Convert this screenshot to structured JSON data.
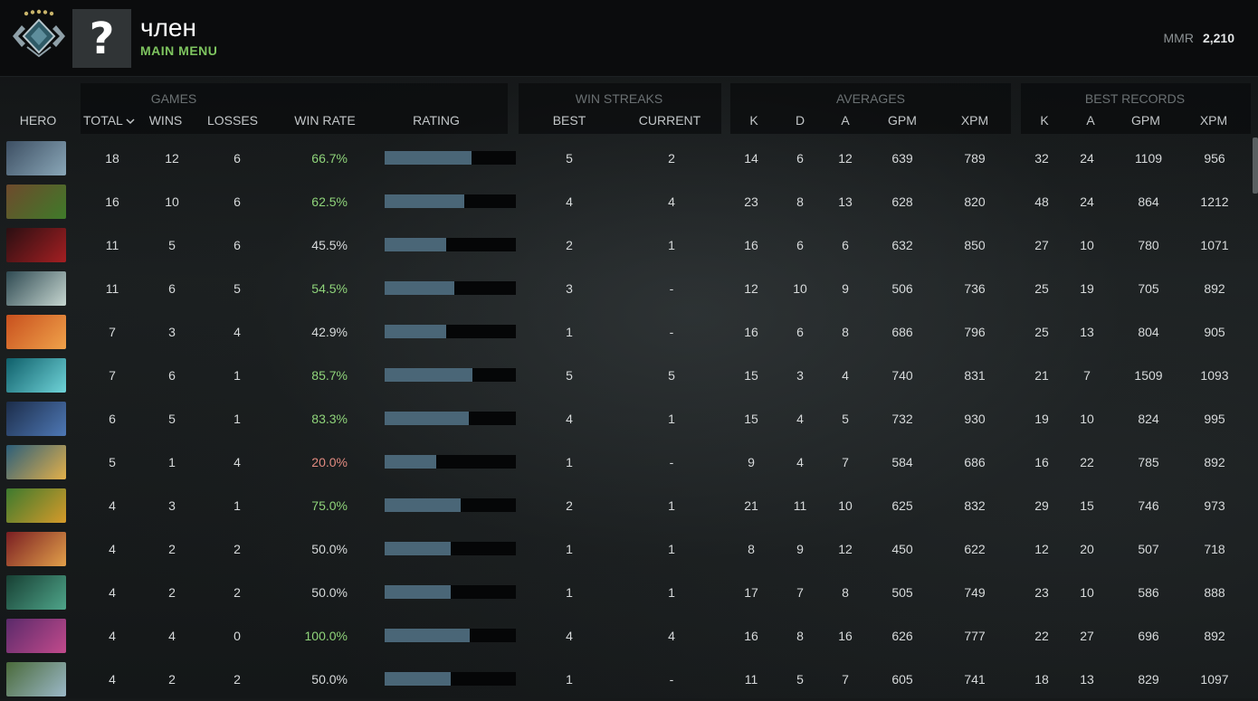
{
  "header": {
    "player_name": "член",
    "subtitle": "MAIN MENU",
    "mmr_label": "MMR",
    "mmr_value": "2,210"
  },
  "groups": {
    "games": "GAMES",
    "win_streaks": "WIN STREAKS",
    "averages": "AVERAGES",
    "best_records": "BEST RECORDS"
  },
  "columns": {
    "hero": "HERO",
    "total": "TOTAL",
    "total_sort_icon": "chevron-down-icon",
    "wins": "WINS",
    "losses": "LOSSES",
    "win_rate": "WIN RATE",
    "rating": "RATING",
    "best": "BEST",
    "current": "CURRENT",
    "k": "K",
    "d": "D",
    "a": "A",
    "gpm": "GPM",
    "xpm": "XPM",
    "best_k": "K",
    "best_a": "A",
    "best_gpm": "GPM",
    "best_xpm": "XPM"
  },
  "colors": {
    "winrate_good": "#8fd47a",
    "winrate_bad": "#e28b80",
    "winrate_even": "#d7dadb",
    "rating_bar": "#4a6677"
  },
  "rows": [
    {
      "hero_icon": "hero-portrait-icon",
      "c1": "#3d4f63",
      "c2": "#8aa7b8",
      "total": "18",
      "wins": "12",
      "losses": "6",
      "win_rate": "66.7%",
      "wr_tone": "good",
      "rating": 0.66,
      "best": "5",
      "current": "2",
      "k": "14",
      "d": "6",
      "a": "12",
      "gpm": "639",
      "xpm": "789",
      "bk": "32",
      "ba": "24",
      "bgpm": "1109",
      "bxpm": "956"
    },
    {
      "hero_icon": "hero-portrait-icon",
      "c1": "#6e4a2c",
      "c2": "#3f7a2a",
      "total": "16",
      "wins": "10",
      "losses": "6",
      "win_rate": "62.5%",
      "wr_tone": "good",
      "rating": 0.61,
      "best": "4",
      "current": "4",
      "k": "23",
      "d": "8",
      "a": "13",
      "gpm": "628",
      "xpm": "820",
      "bk": "48",
      "ba": "24",
      "bgpm": "864",
      "bxpm": "1212"
    },
    {
      "hero_icon": "hero-portrait-icon",
      "c1": "#2a0f12",
      "c2": "#a41f22",
      "total": "11",
      "wins": "5",
      "losses": "6",
      "win_rate": "45.5%",
      "wr_tone": "even",
      "rating": 0.47,
      "best": "2",
      "current": "1",
      "k": "16",
      "d": "6",
      "a": "6",
      "gpm": "632",
      "xpm": "850",
      "bk": "27",
      "ba": "10",
      "bgpm": "780",
      "bxpm": "1071"
    },
    {
      "hero_icon": "hero-portrait-icon",
      "c1": "#2f4a52",
      "c2": "#c6d6d0",
      "total": "11",
      "wins": "6",
      "losses": "5",
      "win_rate": "54.5%",
      "wr_tone": "good",
      "rating": 0.53,
      "best": "3",
      "current": "-",
      "k": "12",
      "d": "10",
      "a": "9",
      "gpm": "506",
      "xpm": "736",
      "bk": "25",
      "ba": "19",
      "bgpm": "705",
      "bxpm": "892"
    },
    {
      "hero_icon": "hero-portrait-icon",
      "c1": "#c8501e",
      "c2": "#f0a24a",
      "total": "7",
      "wins": "3",
      "losses": "4",
      "win_rate": "42.9%",
      "wr_tone": "even",
      "rating": 0.47,
      "best": "1",
      "current": "-",
      "k": "16",
      "d": "6",
      "a": "8",
      "gpm": "686",
      "xpm": "796",
      "bk": "25",
      "ba": "13",
      "bgpm": "804",
      "bxpm": "905"
    },
    {
      "hero_icon": "hero-portrait-icon",
      "c1": "#0f5f6a",
      "c2": "#6fd3d8",
      "total": "7",
      "wins": "6",
      "losses": "1",
      "win_rate": "85.7%",
      "wr_tone": "good",
      "rating": 0.67,
      "best": "5",
      "current": "5",
      "k": "15",
      "d": "3",
      "a": "4",
      "gpm": "740",
      "xpm": "831",
      "bk": "21",
      "ba": "7",
      "bgpm": "1509",
      "bxpm": "1093"
    },
    {
      "hero_icon": "hero-portrait-icon",
      "c1": "#1c2d4a",
      "c2": "#4e78b5",
      "total": "6",
      "wins": "5",
      "losses": "1",
      "win_rate": "83.3%",
      "wr_tone": "good",
      "rating": 0.64,
      "best": "4",
      "current": "1",
      "k": "15",
      "d": "4",
      "a": "5",
      "gpm": "732",
      "xpm": "930",
      "bk": "19",
      "ba": "10",
      "bgpm": "824",
      "bxpm": "995"
    },
    {
      "hero_icon": "hero-portrait-icon",
      "c1": "#2b5e7a",
      "c2": "#e3b04a",
      "total": "5",
      "wins": "1",
      "losses": "4",
      "win_rate": "20.0%",
      "wr_tone": "bad",
      "rating": 0.39,
      "best": "1",
      "current": "-",
      "k": "9",
      "d": "4",
      "a": "7",
      "gpm": "584",
      "xpm": "686",
      "bk": "16",
      "ba": "22",
      "bgpm": "785",
      "bxpm": "892"
    },
    {
      "hero_icon": "hero-portrait-icon",
      "c1": "#3d7a2e",
      "c2": "#d69a2a",
      "total": "4",
      "wins": "3",
      "losses": "1",
      "win_rate": "75.0%",
      "wr_tone": "good",
      "rating": 0.58,
      "best": "2",
      "current": "1",
      "k": "21",
      "d": "11",
      "a": "10",
      "gpm": "625",
      "xpm": "832",
      "bk": "29",
      "ba": "15",
      "bgpm": "746",
      "bxpm": "973"
    },
    {
      "hero_icon": "hero-portrait-icon",
      "c1": "#7a1e22",
      "c2": "#e2a04a",
      "total": "4",
      "wins": "2",
      "losses": "2",
      "win_rate": "50.0%",
      "wr_tone": "even",
      "rating": 0.5,
      "best": "1",
      "current": "1",
      "k": "8",
      "d": "9",
      "a": "12",
      "gpm": "450",
      "xpm": "622",
      "bk": "12",
      "ba": "20",
      "bgpm": "507",
      "bxpm": "718"
    },
    {
      "hero_icon": "hero-portrait-icon",
      "c1": "#173f33",
      "c2": "#4fa58a",
      "total": "4",
      "wins": "2",
      "losses": "2",
      "win_rate": "50.0%",
      "wr_tone": "even",
      "rating": 0.5,
      "best": "1",
      "current": "1",
      "k": "17",
      "d": "7",
      "a": "8",
      "gpm": "505",
      "xpm": "749",
      "bk": "23",
      "ba": "10",
      "bgpm": "586",
      "bxpm": "888"
    },
    {
      "hero_icon": "hero-portrait-icon",
      "c1": "#5a2a6a",
      "c2": "#c24a8c",
      "total": "4",
      "wins": "4",
      "losses": "0",
      "win_rate": "100.0%",
      "wr_tone": "good",
      "rating": 0.65,
      "best": "4",
      "current": "4",
      "k": "16",
      "d": "8",
      "a": "16",
      "gpm": "626",
      "xpm": "777",
      "bk": "22",
      "ba": "27",
      "bgpm": "696",
      "bxpm": "892"
    },
    {
      "hero_icon": "hero-portrait-icon",
      "c1": "#4a6a3a",
      "c2": "#9bb8c8",
      "total": "4",
      "wins": "2",
      "losses": "2",
      "win_rate": "50.0%",
      "wr_tone": "even",
      "rating": 0.5,
      "best": "1",
      "current": "-",
      "k": "11",
      "d": "5",
      "a": "7",
      "gpm": "605",
      "xpm": "741",
      "bk": "18",
      "ba": "13",
      "bgpm": "829",
      "bxpm": "1097"
    }
  ]
}
